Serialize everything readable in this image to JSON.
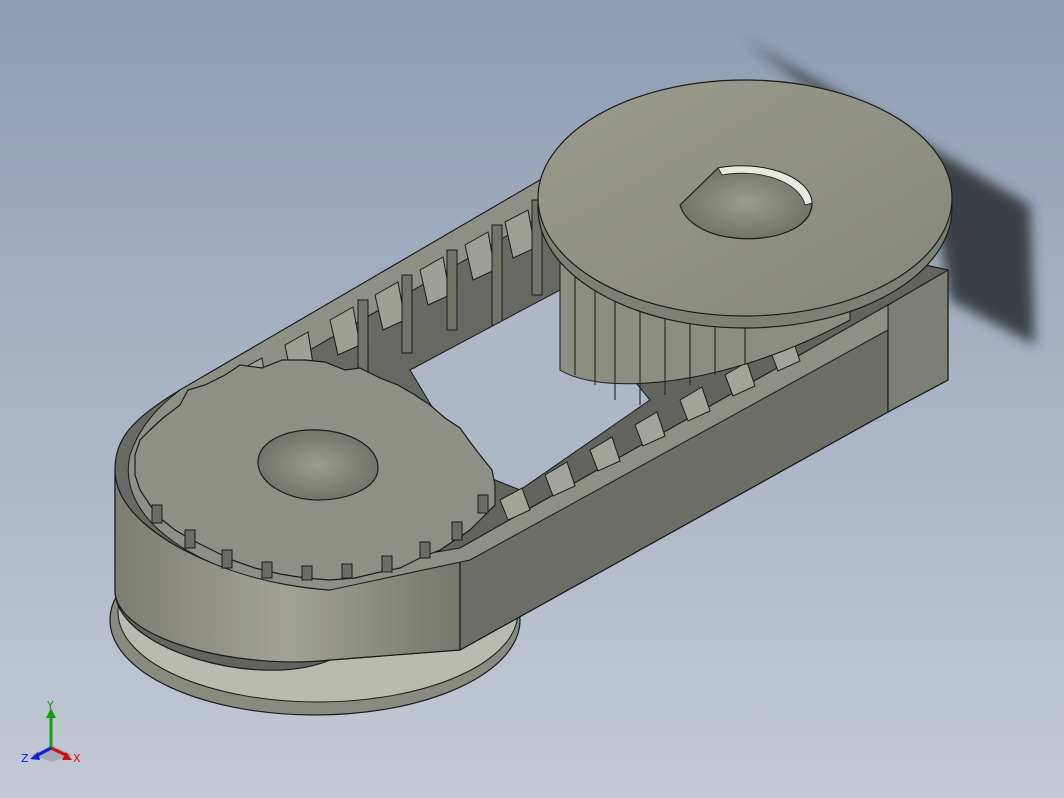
{
  "viewport": {
    "background_top": "#8e9db4",
    "background_bottom": "#c3c9d5"
  },
  "model": {
    "part_color": "#8e8f82",
    "part_shadow": "#5f605a",
    "edge_color": "#1a1a1a",
    "large_pulley_teeth": 20,
    "small_pulley_teeth": 18
  },
  "triad": {
    "x_label": "X",
    "y_label": "Y",
    "z_label": "Z",
    "x_color": "#d01010",
    "y_color": "#10a010",
    "z_color": "#1020d0"
  }
}
